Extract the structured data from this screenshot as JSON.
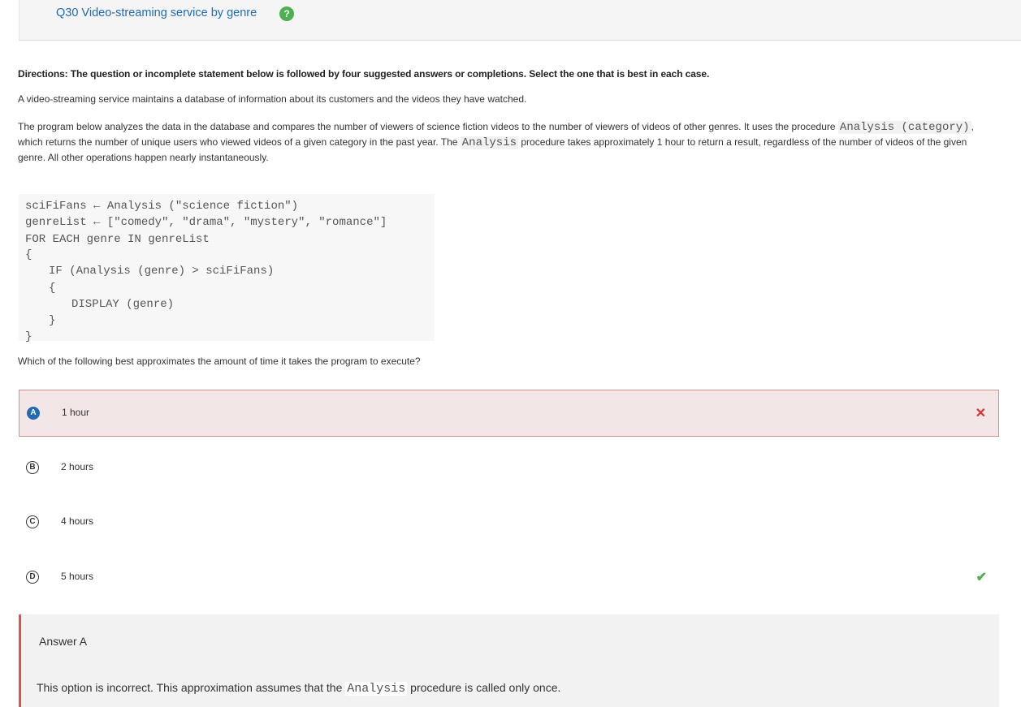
{
  "header": {
    "question_title": "Q30 Video-streaming service by genre",
    "help_icon_glyph": "?",
    "help_icon_color": "#4caf50"
  },
  "directions": "Directions: The question or incomplete statement below is followed by four suggested answers or completions. Select the one that is best in each case.",
  "paragraph1": "A video-streaming service maintains a database of information about its customers and the videos they have watched.",
  "paragraph2": {
    "part1": "The program below analyzes the data in the database and compares the number of viewers of science fiction videos to the number of viewers of videos of other genres. It uses the procedure",
    "code1": "Analysis (category)",
    "part2": ", which returns the number of unique users who viewed videos of a given category in the past year. The",
    "code2": "Analysis",
    "part3": "procedure takes approximately 1 hour to return a result, regardless of the number of videos of the given genre. All other operations happen nearly instantaneously."
  },
  "code": {
    "line1": "sciFiFans ← Analysis (\"science fiction\")",
    "line2": "genreList ← [\"comedy\", \"drama\", \"mystery\", \"romance\"]",
    "line3": "FOR EACH genre IN genreList",
    "line4": "{",
    "line5": "IF (Analysis (genre) > sciFiFans)",
    "line6": "{",
    "line7": "DISPLAY (genre)",
    "line8": "}",
    "line9": "}"
  },
  "question": "Which of the following best approximates the amount of time it takes the program to execute?",
  "options": [
    {
      "letter": "A",
      "text": "1 hour",
      "mark": "✕"
    },
    {
      "letter": "B",
      "text": "2 hours"
    },
    {
      "letter": "C",
      "text": "4 hours"
    },
    {
      "letter": "D",
      "text": "5 hours",
      "mark": "✔"
    }
  ],
  "answer": {
    "title": "Answer A",
    "expl_before": "This option is incorrect. This approximation assumes that the",
    "expl_code": "Analysis",
    "expl_after": "procedure is called only once."
  },
  "colors": {
    "title_link": "#1f6bb8",
    "selected_bg": "#f3e6e6",
    "selected_border": "#e08c8c",
    "wrong_mark": "#dd3333",
    "correct_mark": "#4caf50",
    "answer_border": "#e05050"
  }
}
